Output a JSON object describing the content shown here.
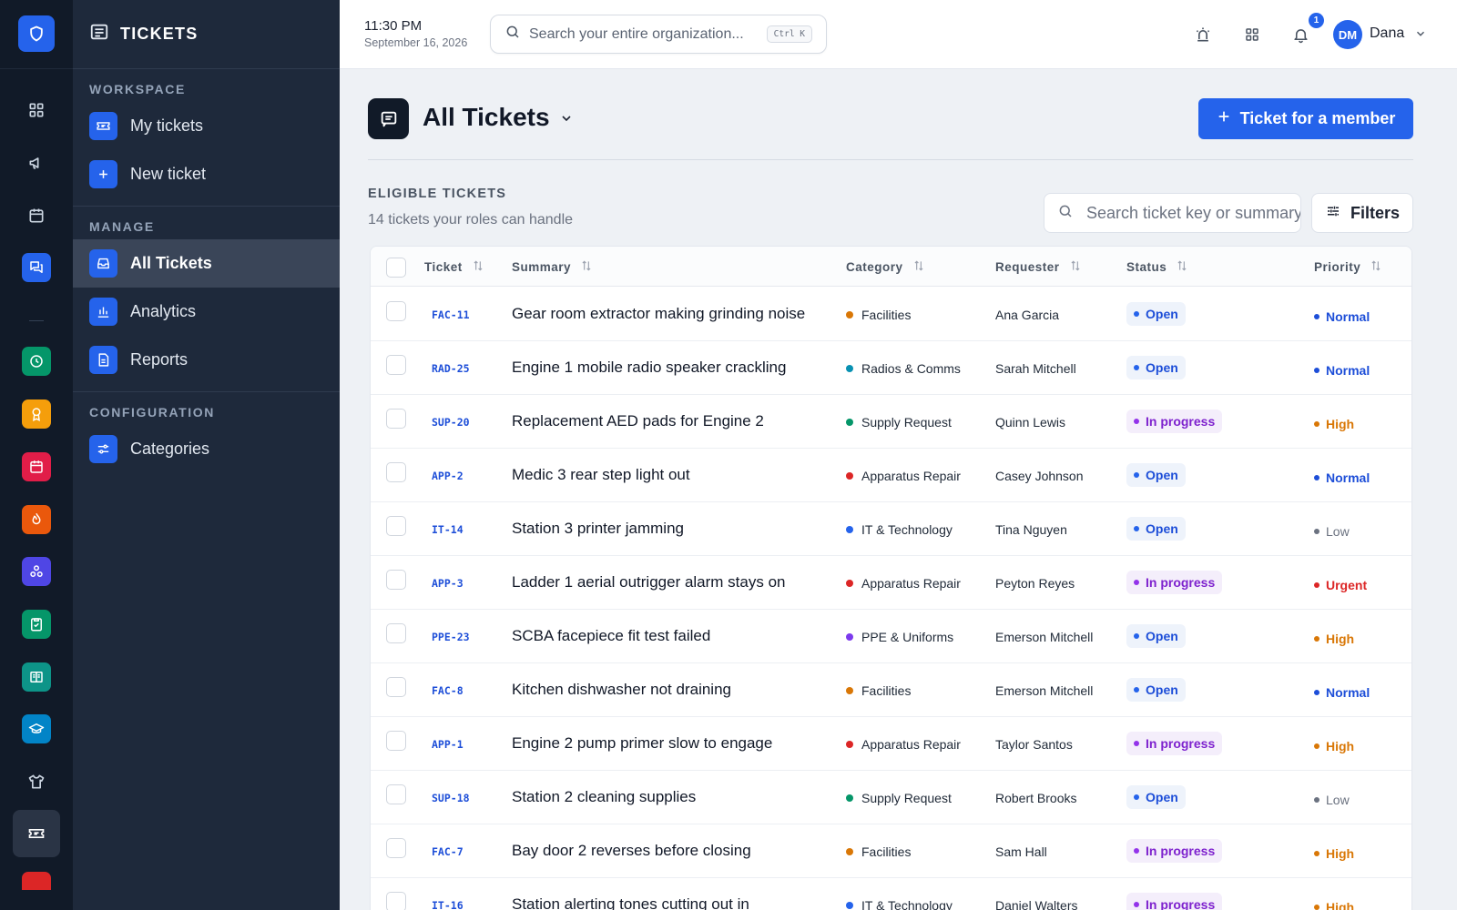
{
  "sidebar": {
    "title": "TICKETS",
    "sections": [
      {
        "label": "WORKSPACE",
        "items": [
          {
            "label": "My tickets",
            "icon": "ticket-icon"
          },
          {
            "label": "New ticket",
            "icon": "plus-icon"
          }
        ]
      },
      {
        "label": "MANAGE",
        "items": [
          {
            "label": "All Tickets",
            "icon": "inbox-icon",
            "active": true
          },
          {
            "label": "Analytics",
            "icon": "bar-chart-icon"
          },
          {
            "label": "Reports",
            "icon": "document-icon"
          }
        ]
      },
      {
        "label": "CONFIGURATION",
        "items": [
          {
            "label": "Categories",
            "icon": "sliders-icon"
          }
        ]
      }
    ]
  },
  "rail": {
    "colors": {
      "logo": "#2563eb",
      "clock": "#059669",
      "award": "#f59e0b",
      "calendar": "#e11d48",
      "flame": "#ea580c",
      "network": "#4f46e5",
      "clipboard": "#059669",
      "book": "#0d9488",
      "graduation": "#0284c7"
    }
  },
  "topbar": {
    "time": "11:30 PM",
    "date": "September 16, 2026",
    "search_placeholder": "Search your entire organization...",
    "search_shortcut": "Ctrl K",
    "notification_count": "1",
    "avatar_initials": "DM",
    "user_name": "Dana"
  },
  "main": {
    "title": "All Tickets",
    "primary_button": "Ticket for a member",
    "section_label": "ELIGIBLE TICKETS",
    "section_sub": "14 tickets your roles can handle",
    "search_placeholder": "Search ticket key or summary",
    "filters_label": "Filters"
  },
  "table": {
    "columns": [
      "Ticket",
      "Summary",
      "Category",
      "Requester",
      "Status",
      "Priority"
    ],
    "rows": [
      {
        "key": "FAC-11",
        "summary": "Gear room extractor making grinding noise",
        "category": "Facilities",
        "cat_color": "#d97706",
        "requester": "Ana Garcia",
        "status": "Open",
        "status_type": "open",
        "priority": "Normal",
        "pri_color": "#1d4ed8"
      },
      {
        "key": "RAD-25",
        "summary": "Engine 1 mobile radio speaker crackling",
        "category": "Radios & Comms",
        "cat_color": "#0891b2",
        "requester": "Sarah Mitchell",
        "status": "Open",
        "status_type": "open",
        "priority": "Normal",
        "pri_color": "#1d4ed8"
      },
      {
        "key": "SUP-20",
        "summary": "Replacement AED pads for Engine 2",
        "category": "Supply Request",
        "cat_color": "#059669",
        "requester": "Quinn Lewis",
        "status": "In progress",
        "status_type": "progress",
        "priority": "High",
        "pri_color": "#d97706"
      },
      {
        "key": "APP-2",
        "summary": "Medic 3 rear step light out",
        "category": "Apparatus Repair",
        "cat_color": "#dc2626",
        "requester": "Casey Johnson",
        "status": "Open",
        "status_type": "open",
        "priority": "Normal",
        "pri_color": "#1d4ed8"
      },
      {
        "key": "IT-14",
        "summary": "Station 3 printer jamming",
        "category": "IT & Technology",
        "cat_color": "#2563eb",
        "requester": "Tina Nguyen",
        "status": "Open",
        "status_type": "open",
        "priority": "Low",
        "pri_color": "#6b7280"
      },
      {
        "key": "APP-3",
        "summary": "Ladder 1 aerial outrigger alarm stays on",
        "category": "Apparatus Repair",
        "cat_color": "#dc2626",
        "requester": "Peyton Reyes",
        "status": "In progress",
        "status_type": "progress",
        "priority": "Urgent",
        "pri_color": "#dc2626"
      },
      {
        "key": "PPE-23",
        "summary": "SCBA facepiece fit test failed",
        "category": "PPE & Uniforms",
        "cat_color": "#7c3aed",
        "requester": "Emerson Mitchell",
        "status": "Open",
        "status_type": "open",
        "priority": "High",
        "pri_color": "#d97706"
      },
      {
        "key": "FAC-8",
        "summary": "Kitchen dishwasher not draining",
        "category": "Facilities",
        "cat_color": "#d97706",
        "requester": "Emerson Mitchell",
        "status": "Open",
        "status_type": "open",
        "priority": "Normal",
        "pri_color": "#1d4ed8"
      },
      {
        "key": "APP-1",
        "summary": "Engine 2 pump primer slow to engage",
        "category": "Apparatus Repair",
        "cat_color": "#dc2626",
        "requester": "Taylor Santos",
        "status": "In progress",
        "status_type": "progress",
        "priority": "High",
        "pri_color": "#d97706"
      },
      {
        "key": "SUP-18",
        "summary": "Station 2 cleaning supplies",
        "category": "Supply Request",
        "cat_color": "#059669",
        "requester": "Robert Brooks",
        "status": "Open",
        "status_type": "open",
        "priority": "Low",
        "pri_color": "#6b7280"
      },
      {
        "key": "FAC-7",
        "summary": "Bay door 2 reverses before closing",
        "category": "Facilities",
        "cat_color": "#d97706",
        "requester": "Sam Hall",
        "status": "In progress",
        "status_type": "progress",
        "priority": "High",
        "pri_color": "#d97706"
      },
      {
        "key": "IT-16",
        "summary": "Station alerting tones cutting out in",
        "category": "IT & Technology",
        "cat_color": "#2563eb",
        "requester": "Daniel Walters",
        "status": "In progress",
        "status_type": "progress",
        "priority": "High",
        "pri_color": "#d97706"
      }
    ]
  }
}
